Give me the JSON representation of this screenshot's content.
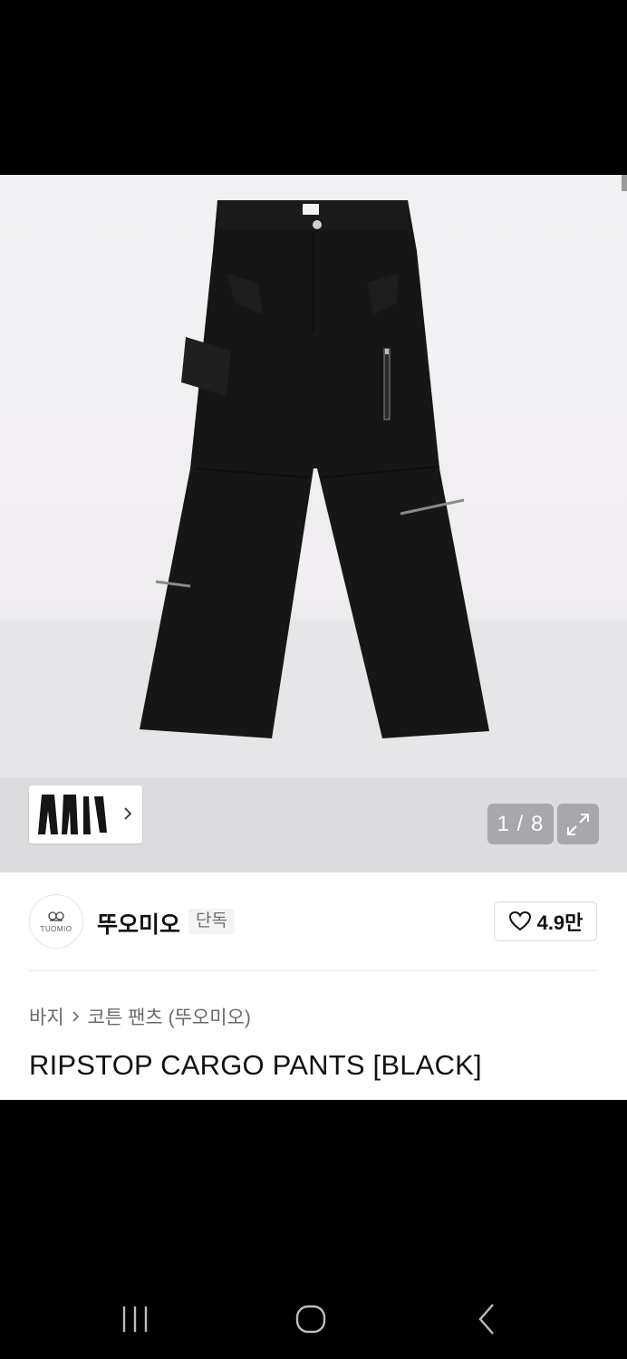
{
  "gallery": {
    "current_index": 1,
    "total_images": 8,
    "counter_text": "1 / 8"
  },
  "brand": {
    "logo_text": "TUOMIO",
    "name": "뚜오미오",
    "exclusive_badge": "단독",
    "like_count": "4.9만"
  },
  "breadcrumb": {
    "category": "바지",
    "subcategory": "코튼 팬츠 (뚜오미오)"
  },
  "product": {
    "title": "RIPSTOP CARGO PANTS [BLACK]"
  },
  "icons": {
    "like": "heart-outline-icon",
    "expand": "expand-icon",
    "thumb_more": "chevron-right-icon",
    "nav_recent": "recent-apps-icon",
    "nav_home": "home-icon",
    "nav_back": "back-icon"
  },
  "colors": {
    "text_primary": "#111111",
    "text_secondary": "#6a6a6e",
    "background": "#ffffff",
    "tag_background": "#f3f3f4"
  }
}
